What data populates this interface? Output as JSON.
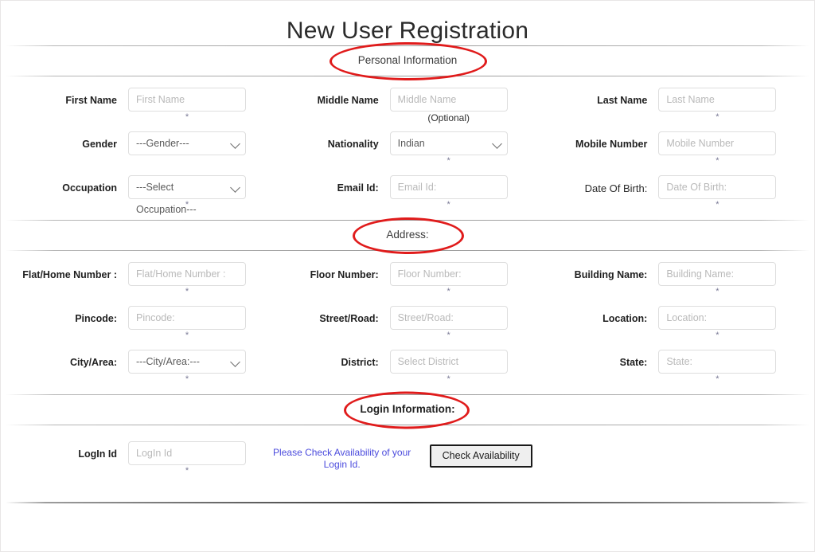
{
  "page": {
    "title": "New User Registration"
  },
  "sections": {
    "personal": {
      "heading": "Personal Information",
      "rows": [
        {
          "fields": [
            {
              "label": "First Name",
              "type": "text",
              "placeholder": "First Name",
              "value": "",
              "marker": "*"
            },
            {
              "label": "Middle Name",
              "type": "text",
              "placeholder": "Middle Name",
              "value": "",
              "marker": "(Optional)"
            },
            {
              "label": "Last Name",
              "type": "text",
              "placeholder": "Last Name",
              "value": "",
              "marker": "*"
            }
          ]
        },
        {
          "fields": [
            {
              "label": "Gender",
              "type": "select",
              "selected": "---Gender---",
              "marker": ""
            },
            {
              "label": "Nationality",
              "type": "select",
              "selected": "Indian",
              "marker": "*"
            },
            {
              "label": "Mobile Number",
              "type": "text",
              "placeholder": "Mobile Number",
              "value": "",
              "marker": "*"
            }
          ]
        },
        {
          "fields": [
            {
              "label": "Occupation",
              "type": "select",
              "selected": "---Select Occupation---",
              "marker": "*"
            },
            {
              "label": "Email Id:",
              "type": "text",
              "placeholder": "Email Id:",
              "value": "",
              "marker": "*"
            },
            {
              "label": "Date Of Birth:",
              "type": "text",
              "placeholder": "Date Of Birth:",
              "value": "",
              "marker": "*",
              "label_style": "normal"
            }
          ]
        }
      ]
    },
    "address": {
      "heading": "Address:",
      "rows": [
        {
          "fields": [
            {
              "label": "Flat/Home Number :",
              "type": "text",
              "placeholder": "Flat/Home Number :",
              "value": "",
              "marker": "*"
            },
            {
              "label": "Floor Number:",
              "type": "text",
              "placeholder": "Floor Number:",
              "value": "",
              "marker": "*"
            },
            {
              "label": "Building Name:",
              "type": "text",
              "placeholder": "Building Name:",
              "value": "",
              "marker": "*"
            }
          ]
        },
        {
          "fields": [
            {
              "label": "Pincode:",
              "type": "text",
              "placeholder": "Pincode:",
              "value": "",
              "marker": "*"
            },
            {
              "label": "Street/Road:",
              "type": "text",
              "placeholder": "Street/Road:",
              "value": "",
              "marker": "*"
            },
            {
              "label": "Location:",
              "type": "text",
              "placeholder": "Location:",
              "value": "",
              "marker": "*"
            }
          ]
        },
        {
          "fields": [
            {
              "label": "City/Area:",
              "type": "select",
              "selected": "---City/Area:---",
              "marker": "*"
            },
            {
              "label": "District:",
              "type": "text",
              "placeholder": "Select District",
              "value": "",
              "marker": "*"
            },
            {
              "label": "State:",
              "type": "text",
              "placeholder": "State:",
              "value": "",
              "marker": "*"
            }
          ]
        }
      ]
    },
    "login": {
      "heading": "Login Information:",
      "login_id_label": "LogIn Id",
      "login_id_placeholder": "LogIn Id",
      "login_id_value": "",
      "login_id_marker": "*",
      "note_line_1": "Please Check Availability of",
      "note_line_2": "your Login Id.",
      "check_button_label": "Check Availability"
    }
  },
  "colors": {
    "annotation_ellipse": "#e01b1b",
    "link_text": "#4b4bdd",
    "title_text": "#2b2b2b",
    "label_text": "#1f1f1f",
    "placeholder_text": "#b9b9b9",
    "input_border": "#dedede",
    "button_border": "#1a1a1a",
    "button_fill": "#efefef"
  }
}
